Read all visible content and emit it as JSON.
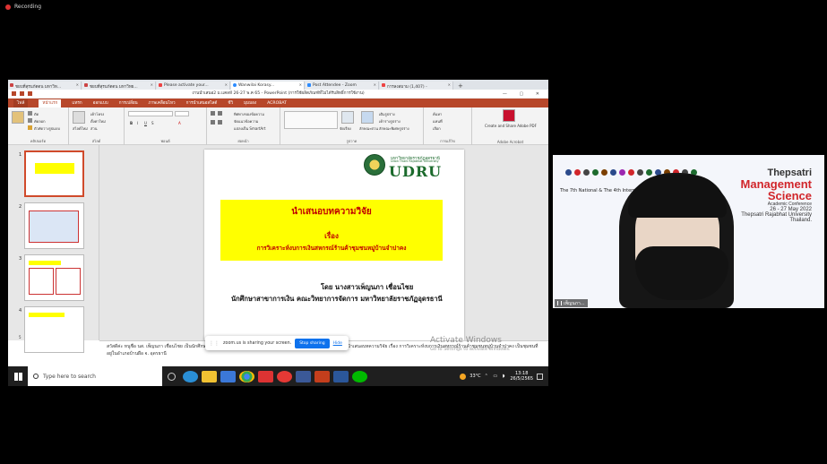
{
  "recording": {
    "label": "Recording"
  },
  "browser_tabs": [
    {
      "label": "ชยบที่สุรบภัตตน มหาวิท...",
      "active": false
    },
    {
      "label": "ชยบที่สุรบภัตตน มหาวิทย...",
      "active": false
    },
    {
      "label": "Please activate your...",
      "active": false
    },
    {
      "label": "Wanwilai Korasy...",
      "active": false
    },
    {
      "label": "Post Attendee - Zoom",
      "active": false
    },
    {
      "label": "การลงสมาม (1,407) -",
      "active": false
    }
  ],
  "new_tab": "+",
  "ppt": {
    "title": "งานนำเสนอ2 ม.แคลห์ 26-27 พ.ค 65 - PowerPoint (การใช้ผลิตภัณฑ์ที่ไม่ได้รับสิทธิ์การใช้งาน)",
    "window_controls": "— ▢ ✕",
    "ribbon_tabs": [
      "ไฟล์",
      "หน้าแรก",
      "แทรก",
      "ออกแบบ",
      "การเปลี่ยน",
      "ภาพเคลื่อนไหว",
      "การนำเสนอสไลด์",
      "ชีวิ",
      "มุมมอง",
      "ACROBAT"
    ],
    "groups": {
      "clipboard": {
        "label": "คลิปบอร์ด",
        "items": [
          "ตัด",
          "คัดลอก",
          "ตัวคัดวางรูปแบบ"
        ]
      },
      "slides": {
        "label": "สไลด์",
        "items": [
          "เค้าโครง",
          "ตั้งค่าใหม่",
          "ส่วน"
        ],
        "new_slide": "สไลด์ใหม่"
      },
      "font": {
        "label": "ฟอนต์",
        "bold": "B",
        "italic": "I",
        "underline": "U",
        "strike": "S",
        "font_color": "A"
      },
      "paragraph": {
        "label": "ย่อหน้า",
        "items": [
          "ทิศทางของข้อความ",
          "จัดแนวข้อความ",
          "แปลงเป็น SmartArt"
        ]
      },
      "drawing": {
        "label": "รูปวาด",
        "arrange": "จัดเรียง",
        "quick_styles": "ลักษณะด่วน",
        "items": [
          "เติมรูปร่าง",
          "เค้าร่างรูปร่าง",
          "ลักษณะพิเศษรูปร่าง"
        ]
      },
      "editing": {
        "label": "การแก้ไข",
        "items": [
          "ค้นหา",
          "แทนที่",
          "เลือก"
        ]
      },
      "adobe": {
        "label": "Adobe Acrobat",
        "button": "Create and Share Adobe PDF"
      }
    },
    "thumbnail_numbers": [
      "1",
      "2",
      "3",
      "4",
      "5"
    ],
    "slide": {
      "univ_th": "มหาวิทยาลัยราชภัฏอุดรธานี",
      "univ_en": "Udon Thani Rajabhat University",
      "univ_abbr": "UDRU",
      "heading": "นำเสนอบทความวิจัย",
      "subject_label": "เรื่อง",
      "subject": "การวิเคราะห์งบการเงินสหกรณ์ร้านค้าชุมชนหมู่บ้านจำปาคง",
      "by": "โดย นางสาวเพ็ญนภา  เชื่อนไชย",
      "affiliation": "นักศึกษาสาขาการเงิน คณะวิทยาการจัดการ มหาวิทยาลัยราชภัฏอุดรธานี"
    },
    "notes": "สวัสดีค่ะ หนูชื่อ นส. เพ็ญนภา เชื่อนไชย เป็นนักศึกษาสาขาการเงิน คณะวิทยาการจัดการ มหาวิทยาลัยราชภัฏอุดรธานี วันนี้จำนำเสนอบทความวิจัย เรื่อง การวิเคราะห์งบการเงินสหกรณ์ร้านค้าชุมชนหมู่บ้านจำปาคง  เป็นชุมชนที่อยู่ในอำเภอบ้านผือ จ. อุดรธานี"
  },
  "windows_watermark": {
    "line1": "Activate Windows",
    "line2": "Go to Settings to activate Windows."
  },
  "zoom_share": {
    "message": "zoom.us is sharing your screen.",
    "stop": "Stop sharing",
    "hide": "Hide"
  },
  "taskbar": {
    "search_placeholder": "Type here to search",
    "temperature": "33°C",
    "time": "13:18",
    "date": "26/5/2565",
    "apps": [
      "task-view",
      "edge",
      "file-explorer",
      "mail",
      "chrome",
      "unknown-red",
      "opera",
      "facebook",
      "powerpoint",
      "word",
      "line"
    ]
  },
  "webcam": {
    "conf_name_1": "Thepsatri",
    "conf_name_2": "Management",
    "conf_name_3": "Science",
    "academic": "Academic Conference",
    "conf_date": "26 - 27 May 2022",
    "univ": "Thepsatri Rajabhat University",
    "country": "Thailand.",
    "seventh": "The 7th National & The 4th International",
    "participant_name": "เพ็ญนภา..."
  },
  "colors": {
    "ppt_accent": "#b7472a",
    "slide_highlight": "#ffff00",
    "slide_text_red": "#c00000",
    "udru_green": "#1b6a2c",
    "zoom_blue": "#0e72ed",
    "conf_red": "#d1262b"
  }
}
